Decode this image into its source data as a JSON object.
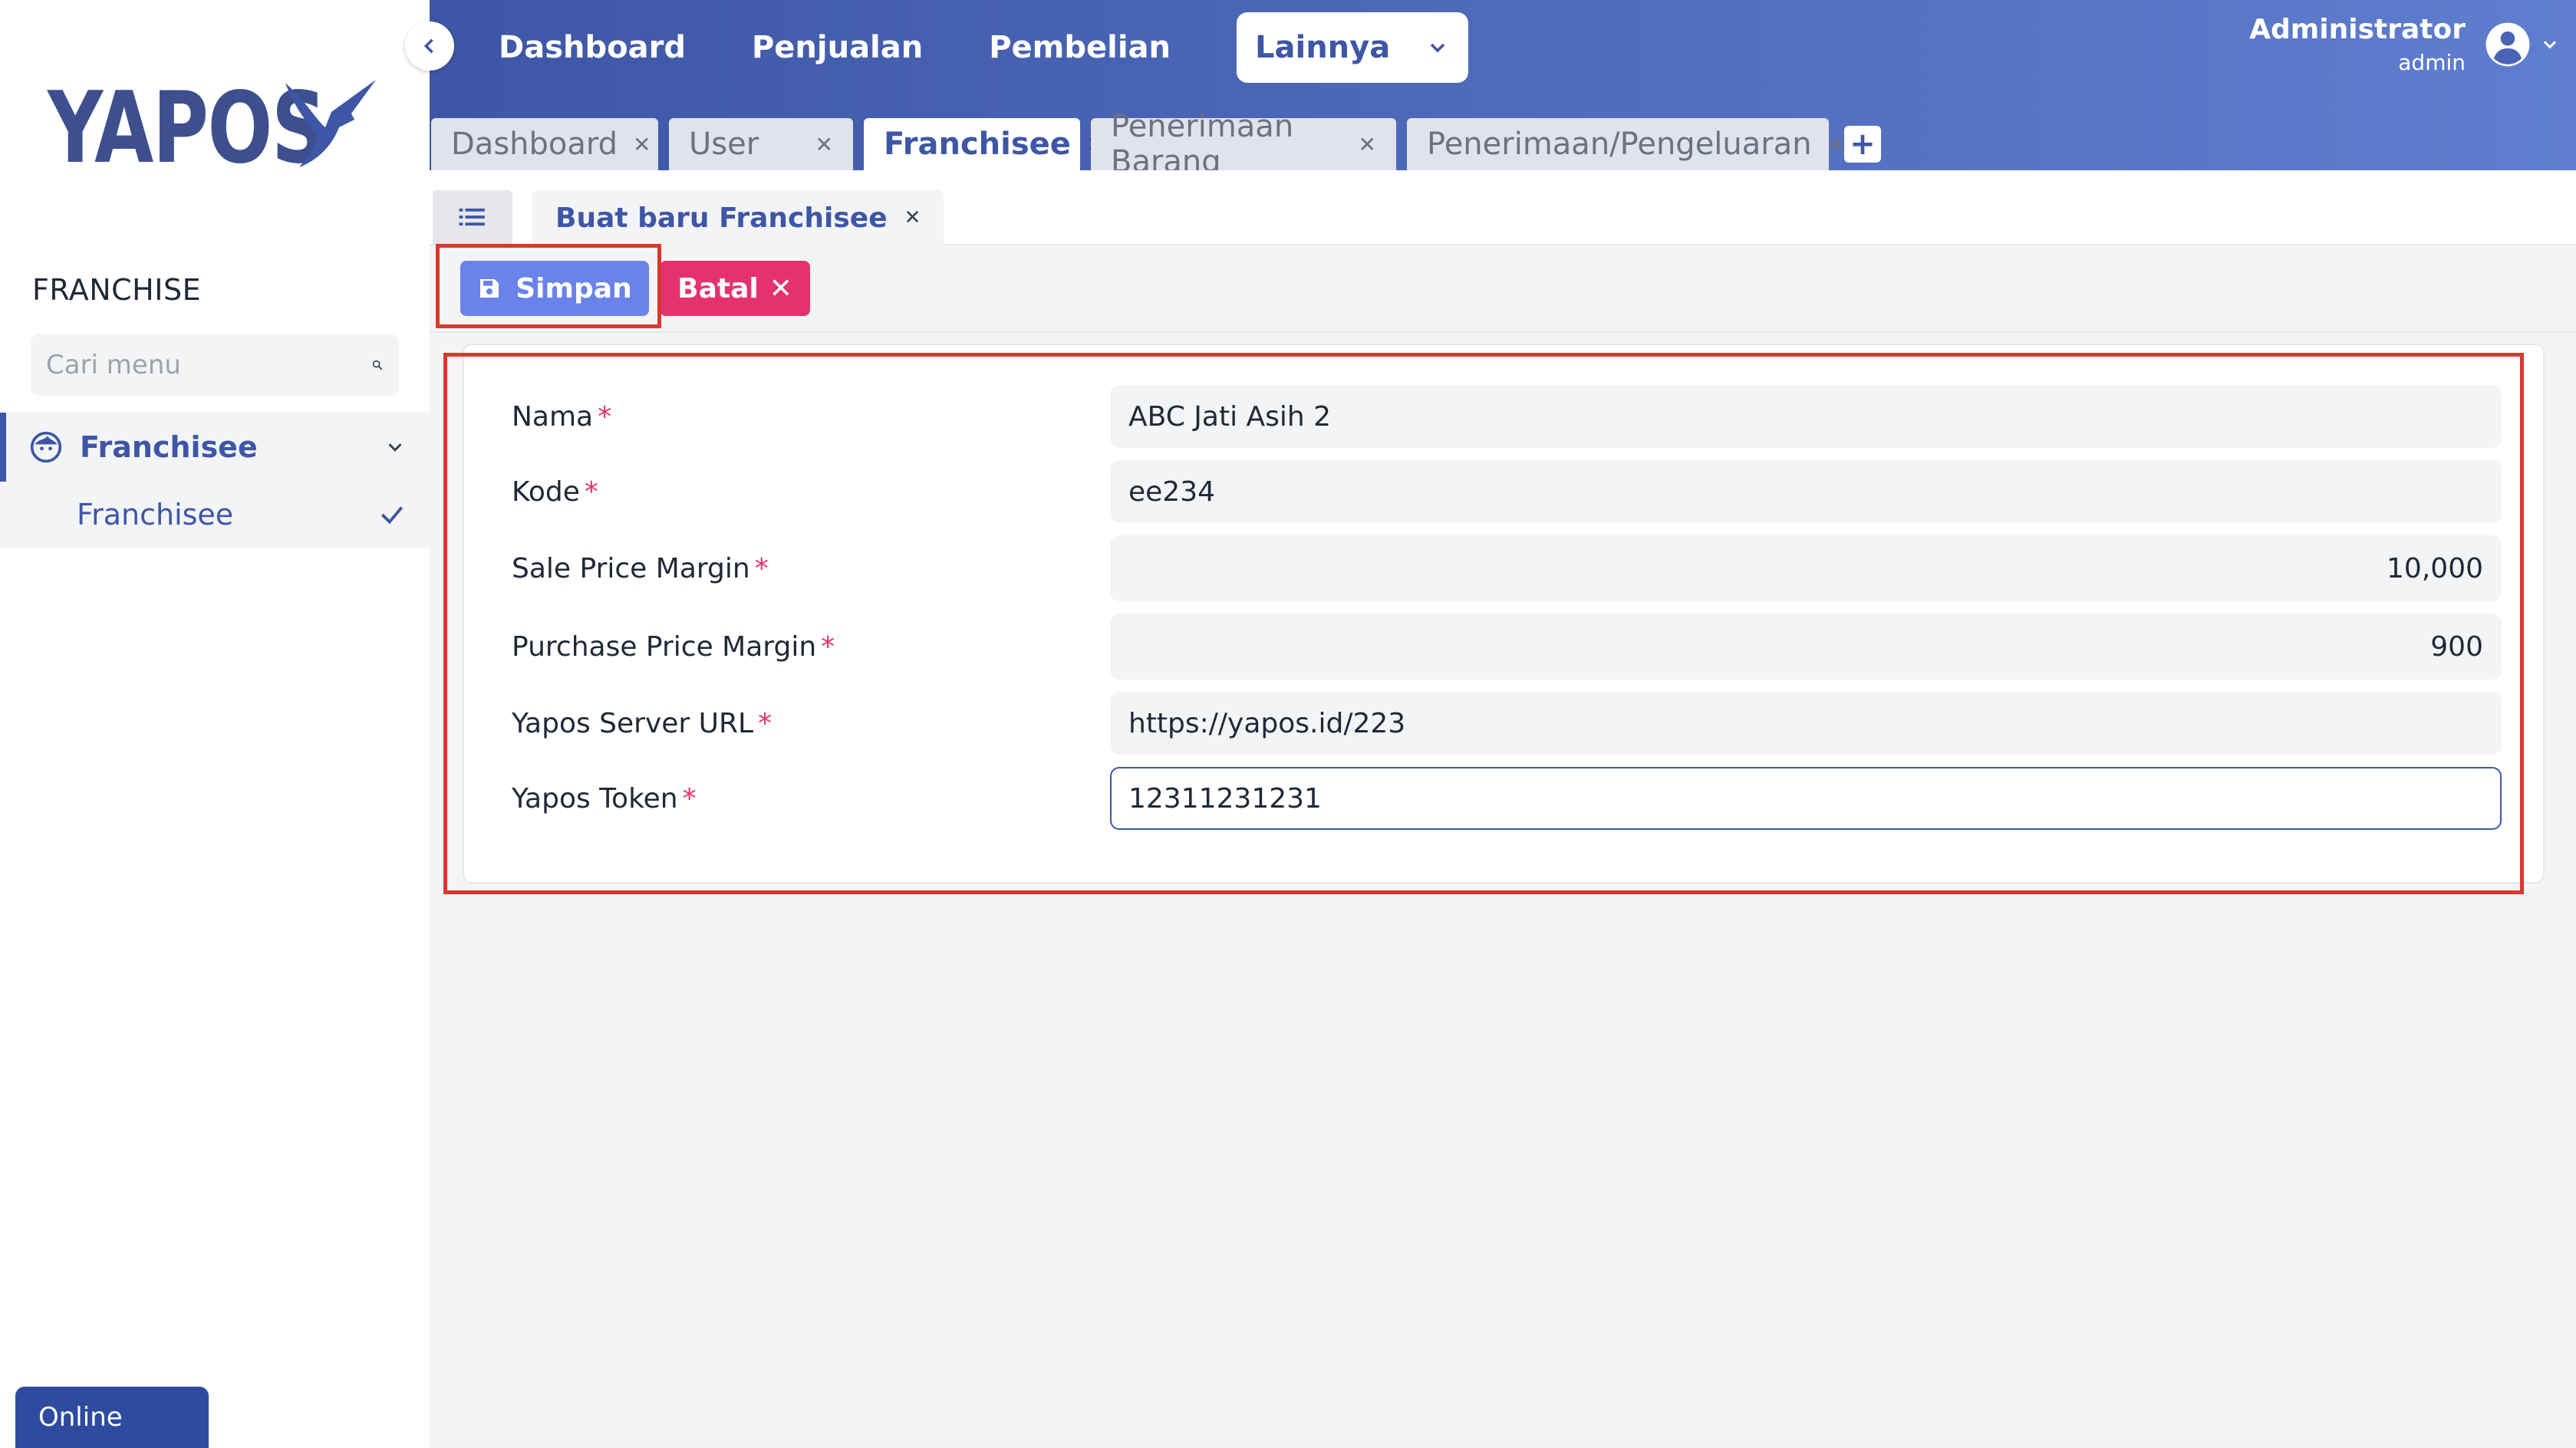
{
  "app": {
    "logo_text": "YAPOS",
    "section_title": "FRANCHISE"
  },
  "sidebar": {
    "search_placeholder": "Cari menu",
    "group_label": "Franchisee",
    "sub_item_label": "Franchisee",
    "status": "Online"
  },
  "header": {
    "nav": [
      "Dashboard",
      "Penjualan",
      "Pembelian"
    ],
    "dropdown_label": "Lainnya",
    "user_name": "Administrator",
    "user_role": "admin"
  },
  "tabs": [
    {
      "label": "Dashboard"
    },
    {
      "label": "User"
    },
    {
      "label": "Franchisee"
    },
    {
      "label": "Penerimaan Barang"
    },
    {
      "label": "Penerimaan/Pengeluaran"
    }
  ],
  "subtab": {
    "label": "Buat baru Franchisee"
  },
  "toolbar": {
    "save_label": "Simpan",
    "cancel_label": "Batal"
  },
  "form": {
    "fields": [
      {
        "label": "Nama",
        "value": "ABC Jati Asih 2"
      },
      {
        "label": "Kode",
        "value": "ee234"
      },
      {
        "label": "Sale Price Margin",
        "value": "10,000"
      },
      {
        "label": "Purchase Price Margin",
        "value": "900"
      },
      {
        "label": "Yapos Server URL",
        "value": "https://yapos.id/223"
      },
      {
        "label": "Yapos Token",
        "value": "12311231231"
      }
    ]
  },
  "colors": {
    "primary": "#3e56a6",
    "save_button": "#6a83ea",
    "cancel_button": "#e5326c",
    "highlight": "#d9382c"
  }
}
